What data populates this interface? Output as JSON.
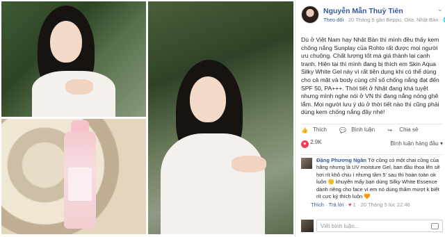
{
  "post": {
    "author": "Nguyễn Mẫn Thuỳ Tiên",
    "follow": "Theo dõi",
    "meta_detail": " · 20 Tháng 5 gần Beppu, Oita, Nhật Bản · ",
    "more_icon": "chevron-down-icon",
    "caption": "Dù ở Việt Nam hay Nhật Bản thì mình đều thấy kem chống nắng Sunplay của Rohto rất được mọi người ưu chuộng. Chất lượng tốt mà giá thành lại cạnh tranh. Hiện tại thì mình đang bị thích em Skin Aqua Silky White Gel này vì rất tiện dụng khi có thể dùng cho cả mặt và body cùng chỉ số chống nắng đạt đến SPF 50, PA+++. Thời tiết ở Nhật đang khá tuyệt nhưng mình nghe nói ở VN thì đang nắng nóng ghê lắm. Mọi người lưu ý dù ở thời tiết nào thì cũng phải dùng kem chống nắng đầy nhé!"
  },
  "actions": {
    "like": "Thích",
    "comment": "Bình luận",
    "share": "Chia sẻ"
  },
  "reactions": {
    "count": "2.9K",
    "sort_label": "Bình luận hàng đầu"
  },
  "comment": {
    "author": "Đặng Phương Ngân",
    "text": " Tớ cũng có một chai cũng của hãng nhưng là UV moisture Gel, ban đầu thoa lên sẽ hơi rít khô chịu í nhưng tầm 5’ sau thì hoàn toàn ok luôn 🙂 khuyên mấy bạn dùng Silky White Essence dành riêng cho face vì em nó dùng thấm mượt k biết rít cực kỳ thích luôn 🧡",
    "like": "Thích",
    "reply": "Trả lời",
    "heart": "1",
    "time": "20 Tháng 5 lúc 22:46"
  },
  "new_comment": {
    "placeholder": "Viết bình luận..."
  },
  "colors": {
    "link": "#365899",
    "muted": "#90949c",
    "heart": "#f33e58"
  }
}
